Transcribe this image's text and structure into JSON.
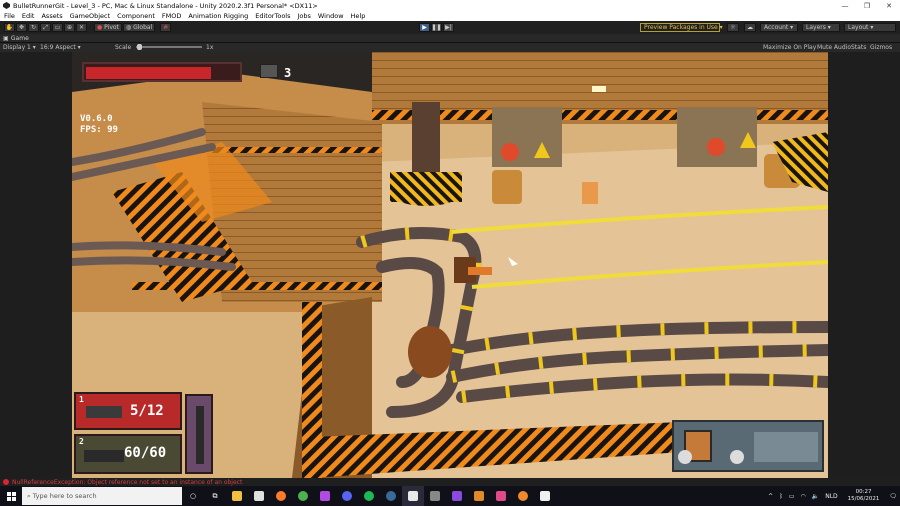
{
  "window": {
    "title": "BulletRunnerGit - Level_3 - PC, Mac & Linux Standalone - Unity 2020.2.3f1 Personal* <DX11>",
    "minimize": "—",
    "maximize": "❐",
    "close": "✕"
  },
  "menu": [
    "File",
    "Edit",
    "Assets",
    "GameObject",
    "Component",
    "FMOD",
    "Animation Rigging",
    "EditorTools",
    "Jobs",
    "Window",
    "Help"
  ],
  "toolbar": {
    "pivot": "Pivot",
    "global": "Global",
    "preview_packages": "Preview Packages in Use",
    "account": "Account",
    "layers": "Layers",
    "layout": "Layout"
  },
  "game_tab": {
    "label": "Game"
  },
  "game_bar": {
    "display": "Display 1",
    "aspect": "16:9 Aspect",
    "scale_label": "Scale",
    "scale_value": "1x",
    "maximize": "Maximize On Play",
    "mute": "Mute Audio",
    "stats": "Stats",
    "gizmos": "Gizmos"
  },
  "hud": {
    "health_fraction": 0.82,
    "lives": "3",
    "version": "V0.6.0",
    "fps": "FPS: 99",
    "weapon1_slot": "1",
    "weapon1_ammo": "5/12",
    "weapon2_slot": "2",
    "weapon2_ammo": "60/60"
  },
  "status": {
    "error": "NullReferenceException: Object reference not set to an instance of an object"
  },
  "taskbar": {
    "search_placeholder": "Type here to search",
    "language": "NLD",
    "time": "00:27",
    "date": "15/06/2021"
  },
  "colors": {
    "accent_blue": "#3d5f8a",
    "preview_yellow": "#e0c24a",
    "hud_red": "#c8262b",
    "hazard_orange": "#f08a1c"
  }
}
